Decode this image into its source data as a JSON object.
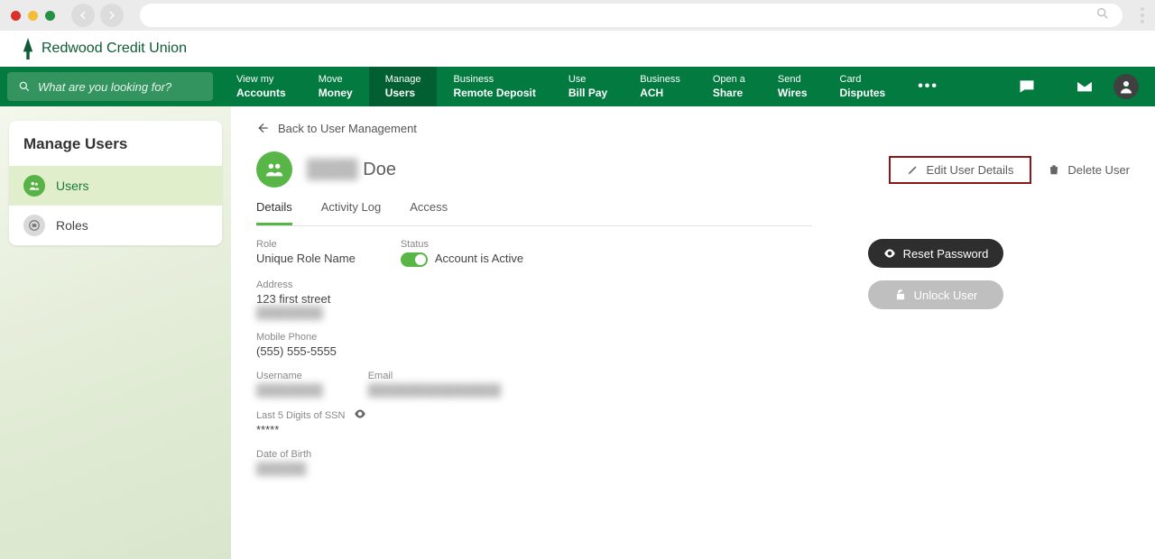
{
  "brand": {
    "name": "Redwood Credit Union"
  },
  "search_prompt": "What are you looking for?",
  "nav": [
    {
      "l1": "View my",
      "l2": "Accounts"
    },
    {
      "l1": "Move",
      "l2": "Money"
    },
    {
      "l1": "Manage",
      "l2": "Users"
    },
    {
      "l1": "Business",
      "l2": "Remote Deposit"
    },
    {
      "l1": "Use",
      "l2": "Bill Pay"
    },
    {
      "l1": "Business",
      "l2": "ACH"
    },
    {
      "l1": "Open a",
      "l2": "Share"
    },
    {
      "l1": "Send",
      "l2": "Wires"
    },
    {
      "l1": "Card",
      "l2": "Disputes"
    }
  ],
  "sidebar": {
    "title": "Manage Users",
    "items": [
      {
        "label": "Users"
      },
      {
        "label": "Roles"
      }
    ]
  },
  "back_label": "Back to User Management",
  "user": {
    "first_masked": "████",
    "last": "Doe"
  },
  "head_actions": {
    "edit": "Edit User Details",
    "delete": "Delete User"
  },
  "tabs": [
    {
      "label": "Details"
    },
    {
      "label": "Activity Log"
    },
    {
      "label": "Access"
    }
  ],
  "details": {
    "role_label": "Role",
    "role_value": "Unique Role Name",
    "status_label": "Status",
    "status_value": "Account is Active",
    "address_label": "Address",
    "address_line1": "123 first street",
    "address_line2_masked": "████████",
    "mobile_label": "Mobile Phone",
    "mobile_value": "(555) 555-5555",
    "username_label": "Username",
    "username_masked": "████████",
    "email_label": "Email",
    "email_masked": "████████████████",
    "ssn_label": "Last 5 Digits of SSN",
    "ssn_value": "*****",
    "dob_label": "Date of Birth",
    "dob_masked": "██████"
  },
  "buttons": {
    "reset": "Reset Password",
    "unlock": "Unlock User"
  }
}
